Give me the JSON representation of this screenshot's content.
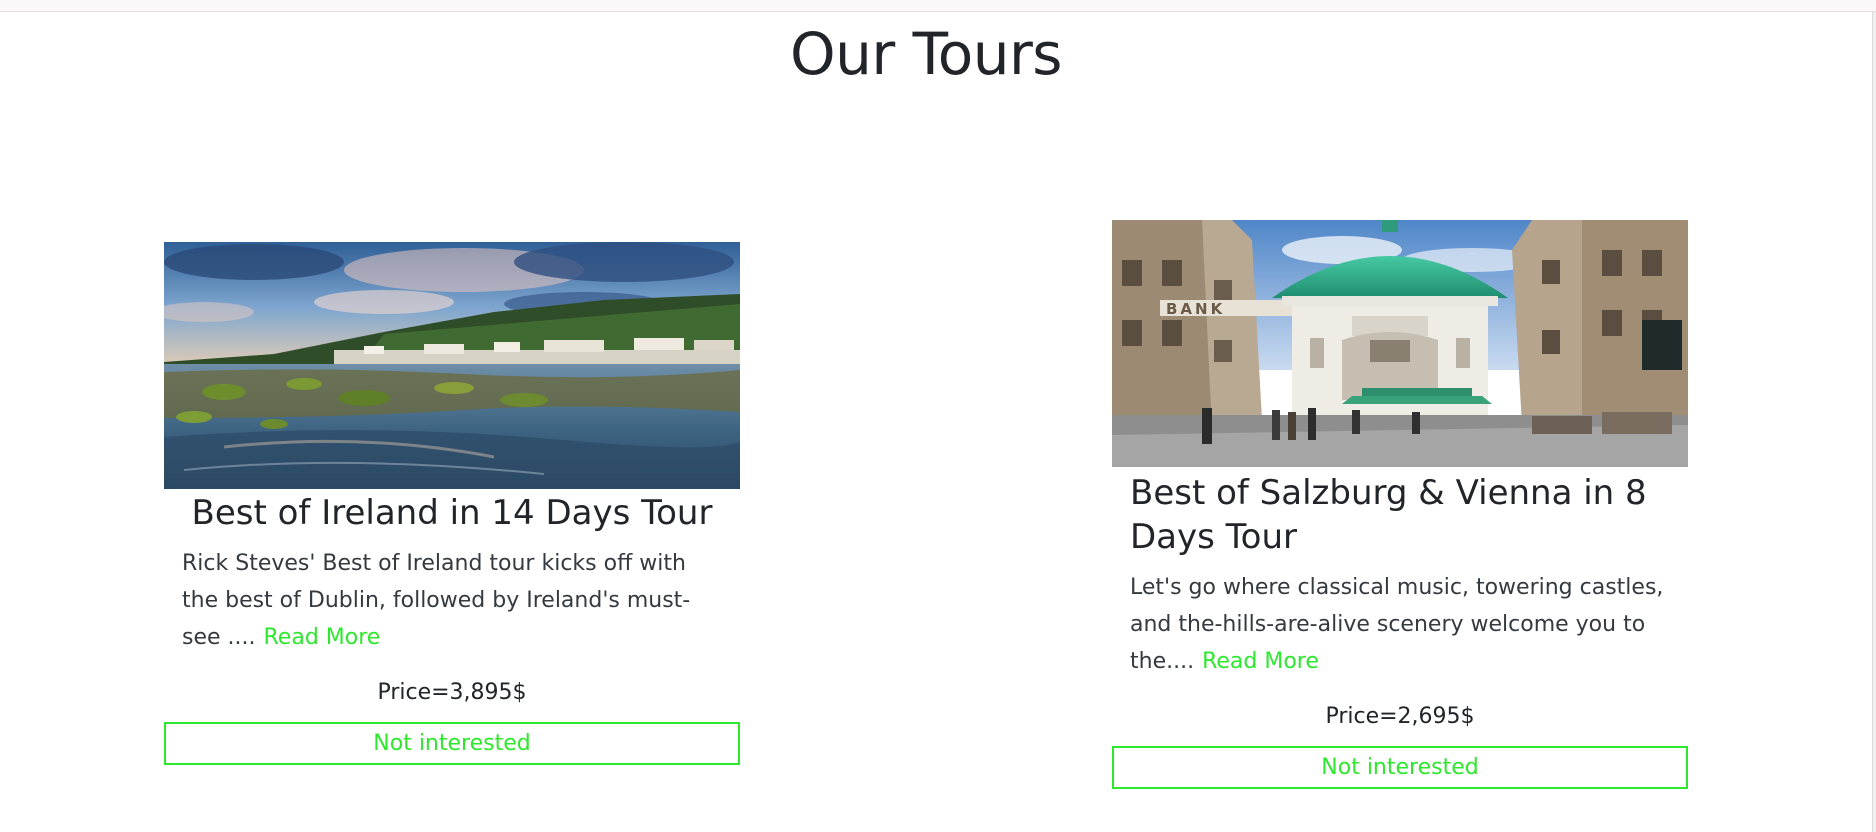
{
  "page": {
    "title": "Our Tours"
  },
  "tours": [
    {
      "title": "Best of Ireland in 14 Days Tour",
      "description": "Rick Steves' Best of Ireland tour kicks off with the best of Dublin, followed by Ireland's must-see ....",
      "read_more": "Read More",
      "price": "Price=3,895$",
      "button": "Not interested"
    },
    {
      "title": "Best of Salzburg & Vienna in 8 Days Tour",
      "description": "Let's go where classical music, towering castles, and the-hills-are-alive scenery welcome you to the....",
      "read_more": "Read More",
      "price": "Price=2,695$",
      "button": "Not interested",
      "image_sign": "BANK"
    }
  ],
  "colors": {
    "accent": "#2ee82e",
    "text": "#212529"
  }
}
